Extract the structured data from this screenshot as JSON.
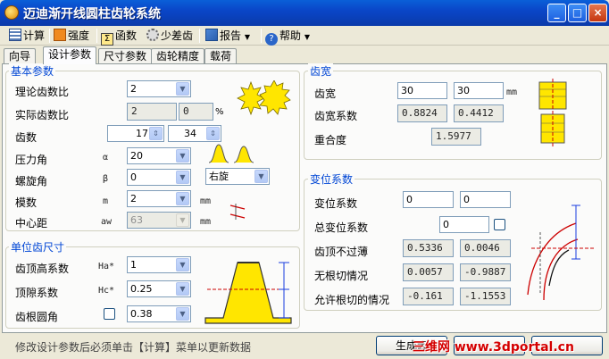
{
  "window": {
    "title": "迈迪渐开线圆柱齿轮系统",
    "min": "_",
    "max": "□",
    "close": "×"
  },
  "toolbar": {
    "calc": "计算",
    "strength": "强度",
    "func": "函数",
    "fewteeth": "少差齿",
    "report": "报告",
    "help": "帮助"
  },
  "tabs": [
    "向导",
    "设计参数",
    "尺寸参数",
    "齿轮精度",
    "载荷"
  ],
  "basic": {
    "title": "基本参数",
    "theory_ratio_label": "理论齿数比",
    "theory_ratio": "2",
    "actual_ratio_label": "实际齿数比",
    "actual_ratio_a": "2",
    "actual_ratio_b": "0",
    "percent": "%",
    "teeth_label": "齿数",
    "z1": "17",
    "z2": "34",
    "pressure_label": "压力角",
    "pressure_sym": "α",
    "pressure": "20",
    "helix_label": "螺旋角",
    "helix_sym": "β",
    "helix": "0",
    "hand": "右旋",
    "module_label": "模数",
    "module_sym": "m",
    "module": "2",
    "module_unit": "mm",
    "center_label": "中心距",
    "center_sym": "aw",
    "center": "63",
    "center_unit": "mm"
  },
  "unit": {
    "title": "单位齿尺寸",
    "ha_label": "齿顶高系数",
    "ha_sym": "Ha*",
    "ha": "1",
    "hc_label": "顶隙系数",
    "hc_sym": "Hc*",
    "hc": "0.25",
    "rho_label": "齿根圆角",
    "rho": "0.38"
  },
  "width": {
    "title": "齿宽",
    "b_label": "齿宽",
    "b1": "30",
    "b2": "30",
    "b_unit": "mm",
    "coef_label": "齿宽系数",
    "coef1": "0.8824",
    "coef2": "0.4412",
    "overlap_label": "重合度",
    "overlap": "1.5977"
  },
  "shift": {
    "title": "变位系数",
    "x_label": "变位系数",
    "x1": "0",
    "x2": "0",
    "total_label": "总变位系数",
    "total": "0",
    "tip_label": "齿顶不过薄",
    "tip1": "0.5336",
    "tip2": "0.0046",
    "root_label": "无根切情况",
    "root1": "0.0057",
    "root2": "-0.9887",
    "allow_label": "允许根切的情况",
    "allow1": "-0.161",
    "allow2": "-1.1553"
  },
  "status": {
    "hint": "修改设计参数后必须单击【计算】菜单以更新数据"
  },
  "buttons": {
    "generate": "生成齿",
    "b2": "",
    "b3": ""
  },
  "watermark": "三维网 www.3dportal.cn",
  "colors": {
    "title_bar": "#0a46c8",
    "group_title": "#0046d5",
    "gear_yellow": "#ffe600",
    "watermark": "#d40000"
  }
}
